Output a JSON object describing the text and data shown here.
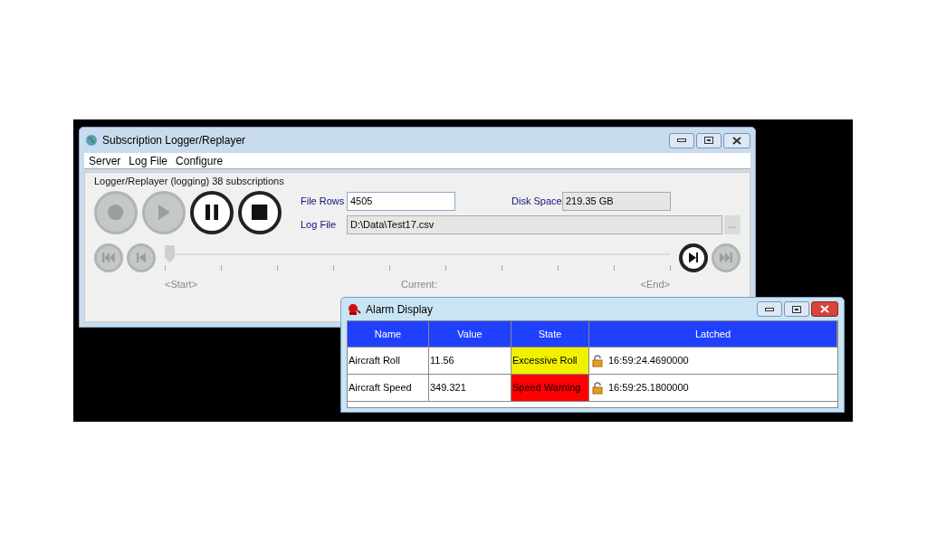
{
  "main_window": {
    "title": "Subscription Logger/Replayer",
    "menu": [
      "Server",
      "Log File",
      "Configure"
    ],
    "status": "Logger/Replayer (logging) 38 subscriptions",
    "transport": [
      {
        "kind": "record",
        "enabled": false
      },
      {
        "kind": "play",
        "enabled": false
      },
      {
        "kind": "pause",
        "enabled": true
      },
      {
        "kind": "stop",
        "enabled": true
      }
    ],
    "file_rows": {
      "label": "File Rows",
      "value": "4505"
    },
    "disk_space": {
      "label": "Disk Space",
      "value": "219.35 GB"
    },
    "log_file": {
      "label": "Log File",
      "value": "D:\\Data\\Test17.csv",
      "browse": "..."
    },
    "seek_left": [
      {
        "kind": "skip-start",
        "enabled": false
      },
      {
        "kind": "step-back",
        "enabled": false
      }
    ],
    "seek_right": [
      {
        "kind": "step-forward",
        "enabled": true
      },
      {
        "kind": "skip-end",
        "enabled": false
      }
    ],
    "slider": {
      "level": 0
    },
    "labels": {
      "start": "<Start>",
      "current": "Current:",
      "end": "<End>"
    }
  },
  "alarm_window": {
    "title": "Alarm Display",
    "columns": [
      "Name",
      "Value",
      "State",
      "Latched"
    ],
    "rows": [
      {
        "name": "Aircraft Roll",
        "value": "11.56",
        "state": "Excessive Roll",
        "color": "#f0f000",
        "latched": "16:59:24.4690000"
      },
      {
        "name": "Aircraft Speed",
        "value": "349.321",
        "state": "Speed Warning",
        "color": "#ff0000",
        "latched": "16:59:25.1800000"
      }
    ]
  }
}
